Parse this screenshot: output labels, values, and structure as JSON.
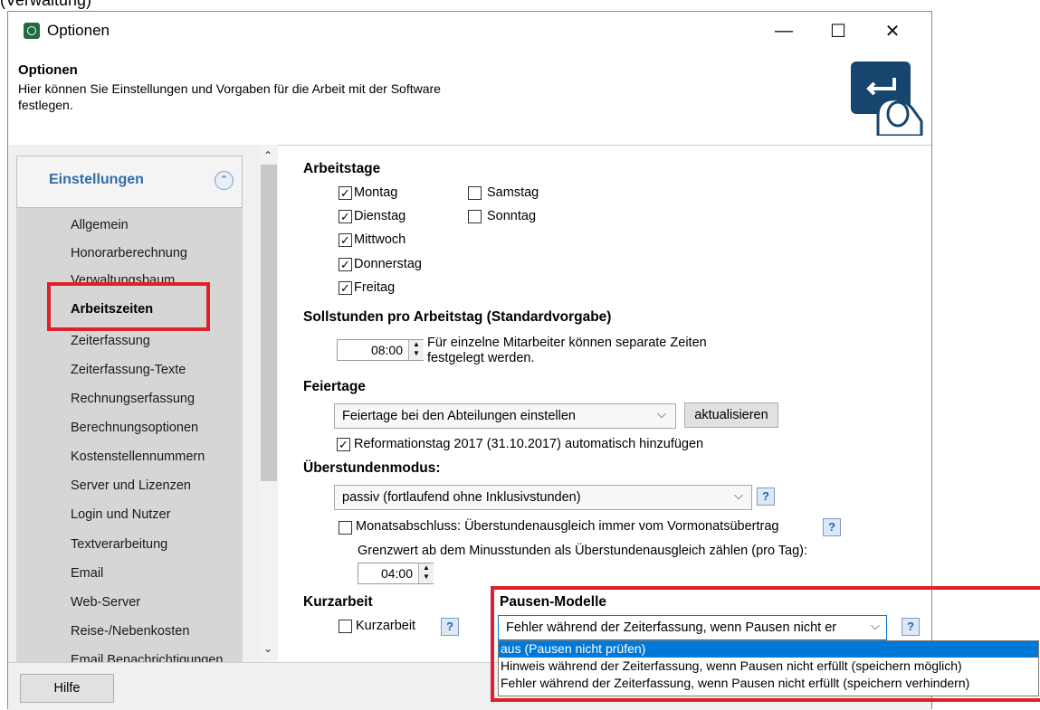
{
  "caption_fragment": "(Verwaltung)",
  "window": {
    "title": "Optionen",
    "controls": {
      "minimize": "—",
      "maximize": "☐",
      "close": "✕"
    }
  },
  "header": {
    "title": "Optionen",
    "description": "Hier können Sie Einstellungen und Vorgaben für die Arbeit mit der Software festlegen."
  },
  "sidebar": {
    "group_label": "Einstellungen",
    "items": [
      {
        "label": "Allgemein"
      },
      {
        "label": "Honorarberechnung"
      },
      {
        "label": "Verwaltungsbaum"
      },
      {
        "label": "Arbeitszeiten",
        "active": true
      },
      {
        "label": "Zeiterfassung"
      },
      {
        "label": "Zeiterfassung-Texte"
      },
      {
        "label": "Rechnungserfassung"
      },
      {
        "label": "Berechnungsoptionen"
      },
      {
        "label": "Kostenstellennummern"
      },
      {
        "label": "Server und Lizenzen"
      },
      {
        "label": "Login und Nutzer"
      },
      {
        "label": "Textverarbeitung"
      },
      {
        "label": "Email"
      },
      {
        "label": "Web-Server"
      },
      {
        "label": "Reise-/Nebenkosten"
      },
      {
        "label": "Email Benachrichtigungen"
      }
    ]
  },
  "arbeitstage": {
    "title": "Arbeitstage",
    "days": [
      {
        "label": "Montag",
        "checked": true
      },
      {
        "label": "Dienstag",
        "checked": true
      },
      {
        "label": "Mittwoch",
        "checked": true
      },
      {
        "label": "Donnerstag",
        "checked": true
      },
      {
        "label": "Freitag",
        "checked": true
      },
      {
        "label": "Samstag",
        "checked": false
      },
      {
        "label": "Sonntag",
        "checked": false
      }
    ]
  },
  "sollstunden": {
    "title": "Sollstunden pro Arbeitstag (Standardvorgabe)",
    "value": "08:00",
    "note": "Für einzelne Mitarbeiter können separate Zeiten festgelegt werden."
  },
  "feiertage": {
    "title": "Feiertage",
    "selected": "Feiertage bei den Abteilungen einstellen",
    "refresh_label": "aktualisieren",
    "reformation_label": "Reformationstag 2017 (31.10.2017) automatisch hinzufügen",
    "reformation_checked": true
  },
  "ueberstunden": {
    "title": "Überstundenmodus:",
    "selected": "passiv (fortlaufend ohne Inklusivstunden)",
    "monatsabschluss_label": "Monatsabschluss: Überstundenausgleich immer vom Vormonatsübertrag",
    "monatsabschluss_checked": false,
    "grenzwert_label": "Grenzwert ab dem Minusstunden als Überstundenausgleich zählen (pro Tag):",
    "grenzwert_value": "04:00"
  },
  "kurzarbeit": {
    "title": "Kurzarbeit",
    "label": "Kurzarbeit",
    "checked": false
  },
  "pausen": {
    "title": "Pausen-Modelle",
    "selected": "Fehler während der Zeiterfassung, wenn Pausen nicht er",
    "options": [
      "aus (Pausen nicht prüfen)",
      "Hinweis während der Zeiterfassung, wenn Pausen nicht erfüllt (speichern möglich)",
      "Fehler während der Zeiterfassung, wenn Pausen nicht erfüllt (speichern verhindern)"
    ]
  },
  "help_glyph": "?",
  "footer": {
    "help_label": "Hilfe"
  },
  "colors": {
    "highlight_red": "#e0202a",
    "link_blue": "#2e6ea8",
    "selection_blue": "#0078d7"
  }
}
